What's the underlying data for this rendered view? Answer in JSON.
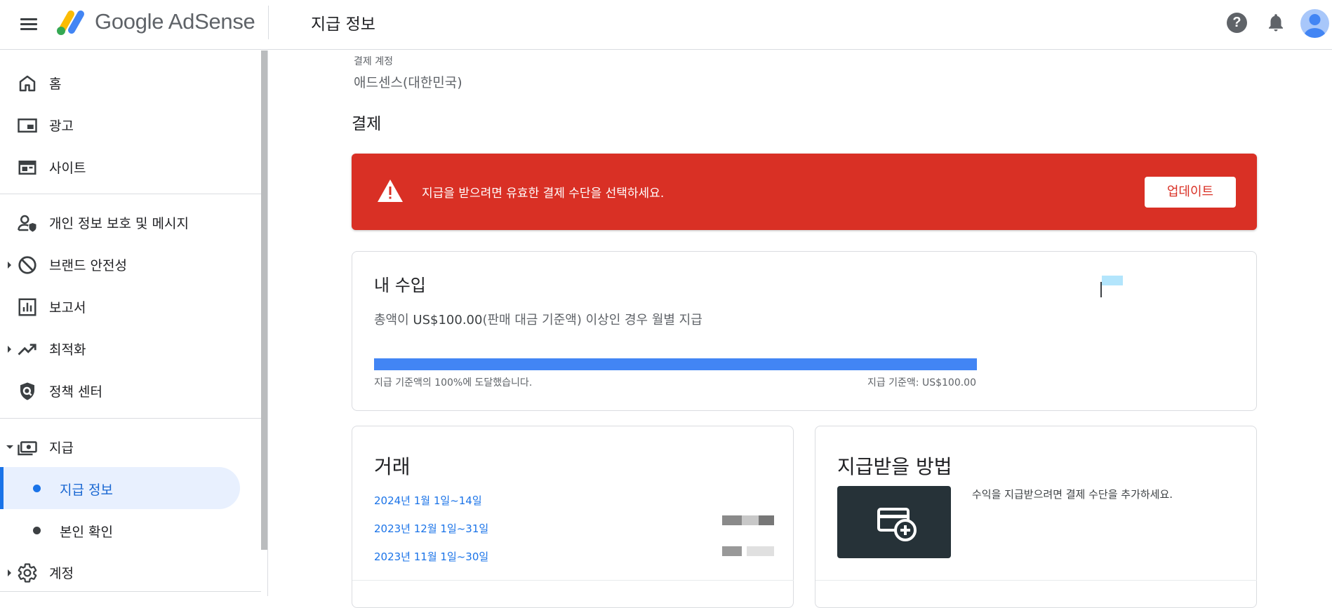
{
  "app": {
    "brand": "Google AdSense",
    "page_title": "지급 정보",
    "help_label": "?"
  },
  "sidebar": {
    "items": [
      {
        "label": "홈",
        "icon": "home-icon"
      },
      {
        "label": "광고",
        "icon": "ads-icon"
      },
      {
        "label": "사이트",
        "icon": "sites-icon"
      },
      {
        "label": "개인 정보 보호 및 메시지",
        "icon": "privacy-messaging-icon"
      },
      {
        "label": "브랜드 안전성",
        "icon": "block-icon"
      },
      {
        "label": "보고서",
        "icon": "reports-icon"
      },
      {
        "label": "최적화",
        "icon": "trending-up-icon"
      },
      {
        "label": "정책 센터",
        "icon": "policy-shield-icon"
      },
      {
        "label": "지급",
        "icon": "payments-icon"
      },
      {
        "label": "계정",
        "icon": "gear-icon"
      }
    ],
    "sub_items": [
      {
        "label": "지급 정보",
        "active": true
      },
      {
        "label": "본인 확인",
        "active": false
      }
    ]
  },
  "account": {
    "label": "결제 계정",
    "value": "애드센스(대한민국)"
  },
  "payments_section": {
    "title": "결제"
  },
  "alert": {
    "message": "지급을 받으려면 유효한 결제 수단을 선택하세요.",
    "button": "업데이트",
    "color": "#d93025"
  },
  "earnings": {
    "title": "내 수입",
    "desc_prefix": "총액이 ",
    "desc_amount": "US$100.00",
    "desc_suffix": "(판매 대금 기준액) 이상인 경우 월별 지급",
    "progress_percent": 100,
    "progress_left": "지급 기준액의 100%에 도달했습니다.",
    "progress_right": "지급 기준액: US$100.00",
    "progress_color": "#4285f4"
  },
  "transactions": {
    "title": "거래",
    "items": [
      "2024년 1월 1일~14일",
      "2023년 12월 1일~31일",
      "2023년 11월 1일~30일"
    ]
  },
  "payment_method": {
    "title": "지급받을 방법",
    "description": "수익을 지급받으려면 결제 수단을 추가하세요.",
    "tile_icon": "add-card-icon"
  }
}
